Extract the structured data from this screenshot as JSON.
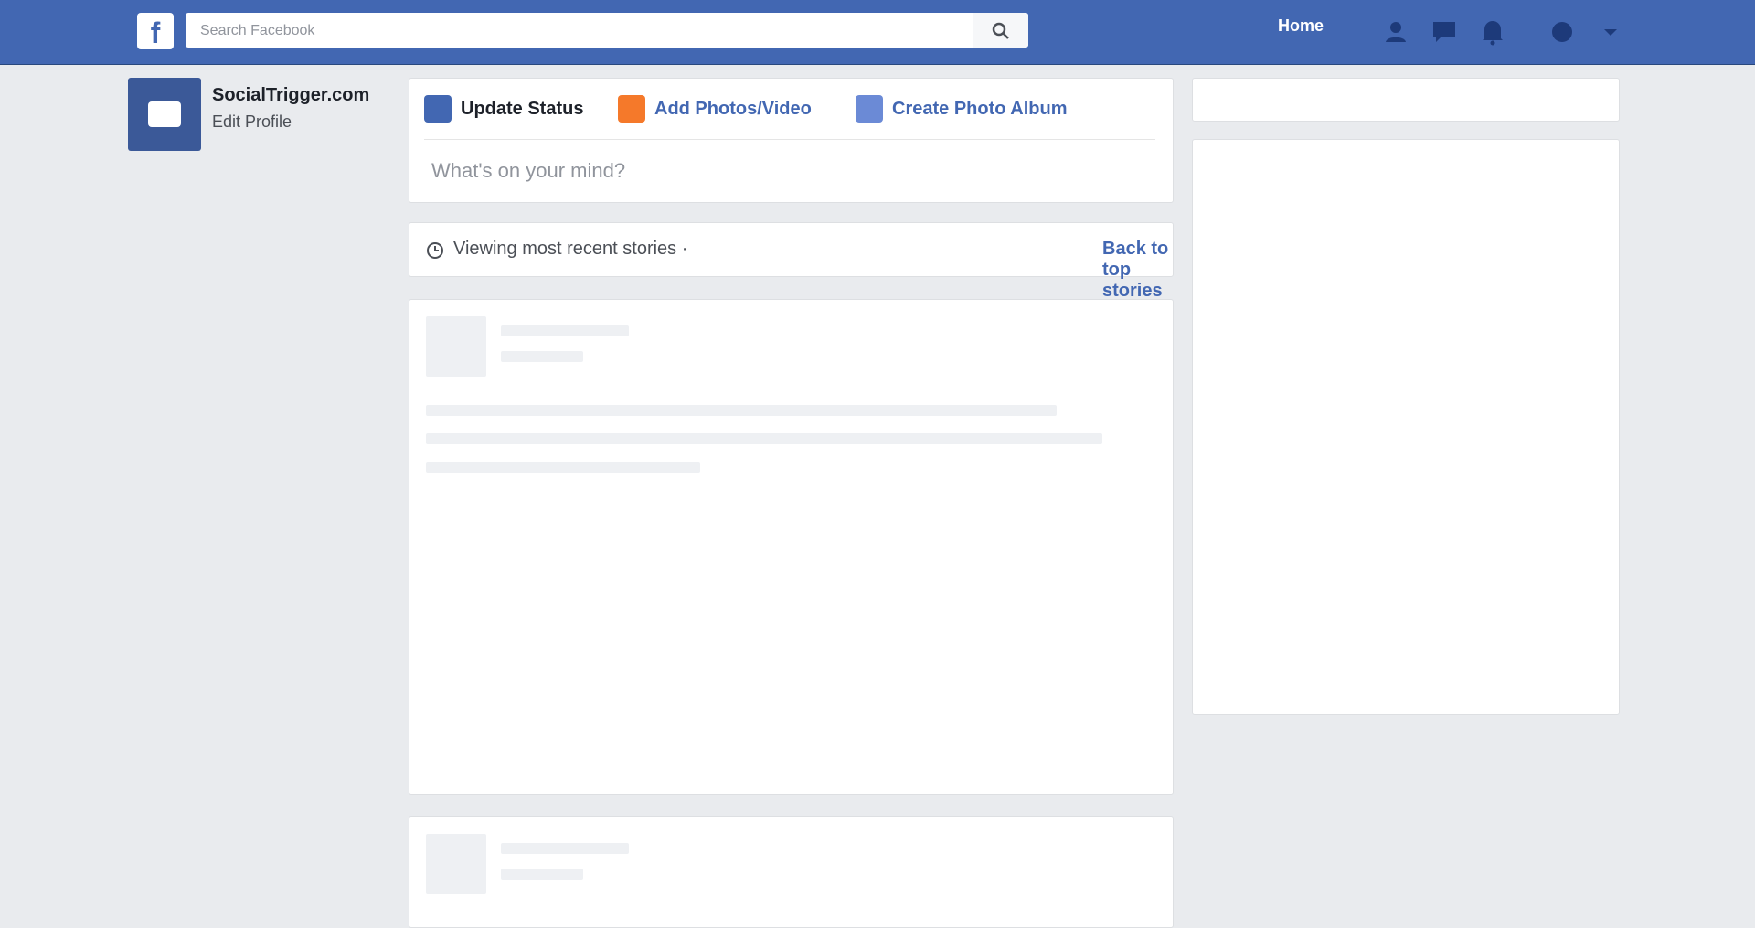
{
  "header": {
    "logo": "f",
    "search_placeholder": "Search Facebook",
    "home_label": "Home",
    "icons": [
      "friend-requests-icon",
      "messages-icon",
      "notifications-icon",
      "quick-help-icon",
      "account-menu-icon"
    ]
  },
  "profile": {
    "name": "SocialTrigger.com",
    "edit_label": "Edit Profile"
  },
  "composer": {
    "tabs": [
      {
        "label": "Update Status",
        "icon": "status-icon",
        "color": "#4267b2"
      },
      {
        "label": "Add Photos/Video",
        "icon": "photo-video-icon",
        "color": "#f5792a"
      },
      {
        "label": "Create Photo Album",
        "icon": "album-icon",
        "color": "#6b8ad6"
      }
    ],
    "placeholder": "What's on your mind?"
  },
  "notice": {
    "text": "Viewing most recent stories ·",
    "link": "Back to top stories"
  },
  "colors": {
    "brand": "#4267b2",
    "background": "#e9ebee"
  }
}
